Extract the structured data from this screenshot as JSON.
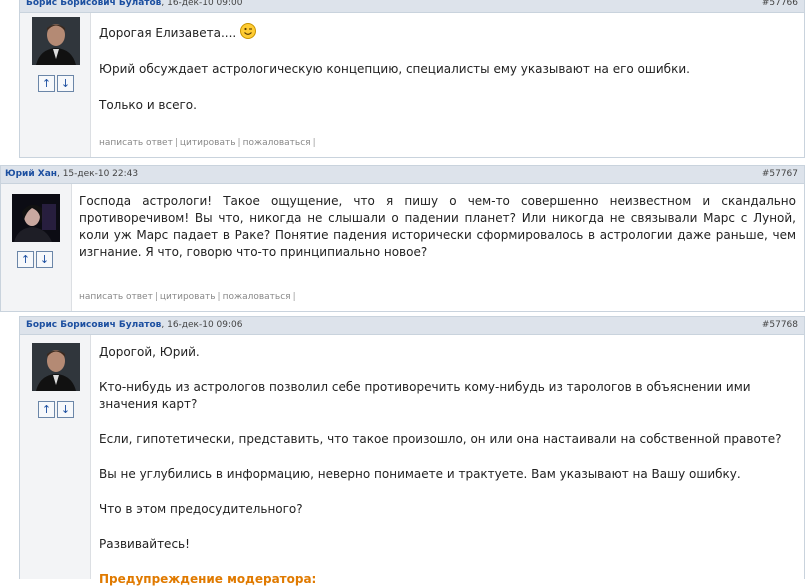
{
  "posts": [
    {
      "author": "Борис Борисович Булатов",
      "date": ", 16-дек-10 09:00",
      "number": "#57766",
      "paragraphs": [
        "Дорогая Елизавета....",
        "Юрий обсуждает астрологическую концепцию, специалисты ему указывают на его ошибки.",
        "Только и всего."
      ],
      "emoji": "wink-smiley"
    },
    {
      "author": "Юрий Хан",
      "date": ", 15-дек-10 22:43",
      "number": "#57767",
      "paragraphs": [
        "Господа астрологи! Такое ощущение, что я пишу о чем-то совершенно неизвестном и скандально противоречивом! Вы что, никогда не слышали о падении планет? Или никогда не связывали Марс с Луной, коли уж Марс падает в Раке? Понятие падения исторически сформировалось в астрологии даже раньше, чем изгнание. Я что, говорю что-то принципиально новое?"
      ]
    },
    {
      "author": "Борис Борисович Булатов",
      "date": ", 16-дек-10 09:06",
      "number": "#57768",
      "paragraphs": [
        "Дорогой, Юрий.",
        "Кто-нибудь из астрологов позволил себе противоречить кому-нибудь из тарологов в объяснении ими значения карт?",
        "Если, гипотетически, представить, что такое произошло, он или она настаивали на собственной правоте?",
        "Вы не углубились в информацию, неверно понимаете и трактуете. Вам указывают на Вашу ошибку.",
        "Что в этом предосудительного?",
        "Развивайтесь!"
      ],
      "warning": "Предупреждение модератора:"
    }
  ],
  "actions": {
    "reply": "написать ответ",
    "quote": "цитировать",
    "report": "пожаловаться",
    "separator": "|"
  },
  "votes": {
    "up": "↑",
    "down": "↓"
  },
  "colors": {
    "author": "#1c4fa0",
    "header_bg": "#dde3eb",
    "warning": "#e07a00"
  }
}
